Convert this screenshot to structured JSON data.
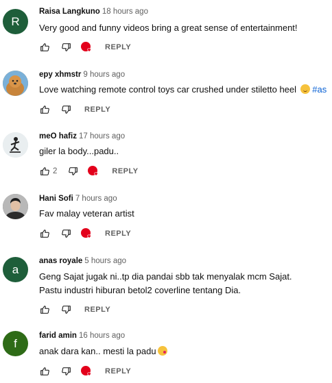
{
  "comments": [
    {
      "author": "Raisa Langkuno",
      "time": "18 hours ago",
      "avatar_letter": "R",
      "avatar_color": "#1e5e3a",
      "text": "Very good and funny videos bring a great sense of entertainment!",
      "likes": "",
      "reply": "REPLY",
      "creator_heart": true
    },
    {
      "author": "epy xhmstr",
      "time": "9 hours ago",
      "avatar_letter": "",
      "avatar_color": "#c9893a",
      "text": "Love watching remote control toys car crushed under stiletto heel",
      "hashtag": "#as",
      "likes": "",
      "reply": "REPLY",
      "creator_heart": false
    },
    {
      "author": "meO hafiz",
      "time": "17 hours ago",
      "avatar_letter": "",
      "avatar_color": "#dfe6ea",
      "text": "giler la body...padu..",
      "likes": "2",
      "reply": "REPLY",
      "creator_heart": true
    },
    {
      "author": "Hani Sofi",
      "time": "7 hours ago",
      "avatar_letter": "",
      "avatar_color": "#5a5a5a",
      "text": "Fav malay veteran artist",
      "likes": "",
      "reply": "REPLY",
      "creator_heart": true
    },
    {
      "author": "anas royale",
      "time": "5 hours ago",
      "avatar_letter": "a",
      "avatar_color": "#1e5e3a",
      "text": "Geng Sajat jugak ni..tp dia pandai sbb tak menyalak mcm Sajat.",
      "text2": "Pastu industri hiburan betol2 coverline tentang Dia.",
      "likes": "",
      "reply": "REPLY",
      "creator_heart": false
    },
    {
      "author": "farid amin",
      "time": "16 hours ago",
      "avatar_letter": "f",
      "avatar_color": "#2e6b17",
      "text": "anak dara kan.. mesti la padu",
      "likes": "",
      "reply": "REPLY",
      "creator_heart": true
    }
  ],
  "colors": {
    "heart": "#e3001b",
    "link": "#065fd4",
    "meta": "#606060"
  },
  "icons": {
    "like": "thumb-up-icon",
    "dislike": "thumb-down-icon",
    "heart": "creator-heart-icon"
  }
}
